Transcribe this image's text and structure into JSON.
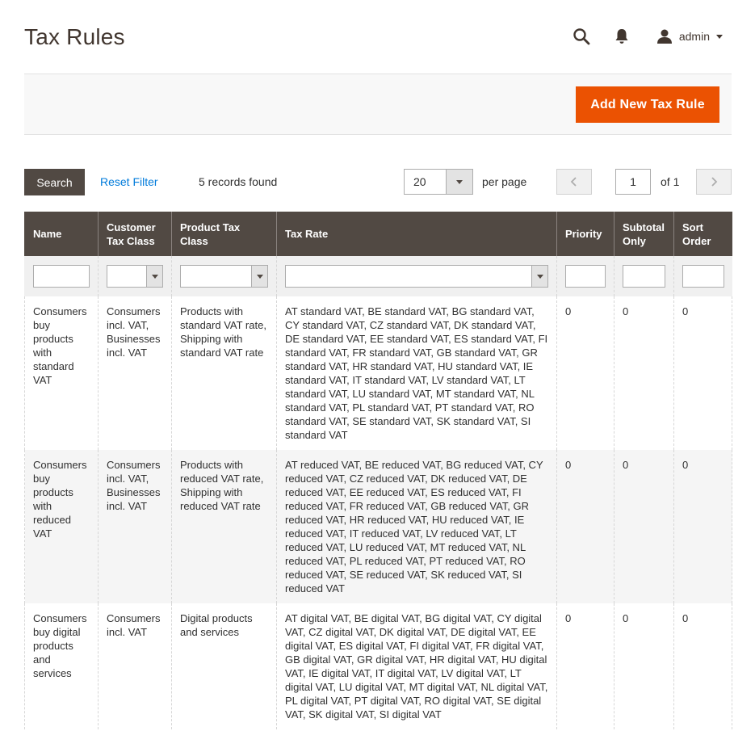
{
  "page": {
    "title": "Tax Rules"
  },
  "header": {
    "user_name": "admin"
  },
  "actions": {
    "add_button": "Add New Tax Rule"
  },
  "toolbar": {
    "search_button": "Search",
    "reset_filter": "Reset Filter",
    "records_found": "5 records found",
    "per_page_value": "20",
    "per_page_label": "per page",
    "current_page": "1",
    "of_pages": "of 1"
  },
  "grid": {
    "columns": [
      "Name",
      "Customer Tax Class",
      "Product Tax Class",
      "Tax Rate",
      "Priority",
      "Subtotal Only",
      "Sort Order"
    ],
    "rows": [
      {
        "name": "Consumers buy products with standard VAT",
        "customer_tax_class": "Consumers incl. VAT, Businesses incl. VAT",
        "product_tax_class": "Products with standard VAT rate, Shipping with standard VAT rate",
        "tax_rate": "AT standard VAT, BE standard VAT, BG standard VAT, CY standard VAT, CZ standard VAT, DK standard VAT, DE standard VAT, EE standard VAT, ES standard VAT, FI standard VAT, FR standard VAT, GB standard VAT, GR standard VAT, HR standard VAT, HU standard VAT, IE standard VAT, IT standard VAT, LV standard VAT, LT standard VAT, LU standard VAT, MT standard VAT, NL standard VAT, PL standard VAT, PT standard VAT, RO standard VAT, SE standard VAT, SK standard VAT, SI standard VAT",
        "priority": "0",
        "subtotal_only": "0",
        "sort_order": "0"
      },
      {
        "name": "Consumers buy products with reduced VAT",
        "customer_tax_class": "Consumers incl. VAT, Businesses incl. VAT",
        "product_tax_class": "Products with reduced VAT rate, Shipping with reduced VAT rate",
        "tax_rate": "AT reduced VAT, BE reduced VAT, BG reduced VAT, CY reduced VAT, CZ reduced VAT, DK reduced VAT, DE reduced VAT, EE reduced VAT, ES reduced VAT, FI reduced VAT, FR reduced VAT, GB reduced VAT, GR reduced VAT, HR reduced VAT, HU reduced VAT, IE reduced VAT, IT reduced VAT, LV reduced VAT, LT reduced VAT, LU reduced VAT, MT reduced VAT, NL reduced VAT, PL reduced VAT, PT reduced VAT, RO reduced VAT, SE reduced VAT, SK reduced VAT, SI reduced VAT",
        "priority": "0",
        "subtotal_only": "0",
        "sort_order": "0"
      },
      {
        "name": "Consumers buy digital products and services",
        "customer_tax_class": "Consumers incl. VAT",
        "product_tax_class": "Digital products and services",
        "tax_rate": "AT digital VAT, BE digital VAT, BG digital VAT, CY digital VAT, CZ digital VAT, DK digital VAT, DE digital VAT, EE digital VAT, ES digital VAT, FI digital VAT, FR digital VAT, GB digital VAT, GR digital VAT, HR digital VAT, HU digital VAT, IE digital VAT, IT digital VAT, LV digital VAT, LT digital VAT, LU digital VAT, MT digital VAT, NL digital VAT, PL digital VAT, PT digital VAT, RO digital VAT, SE digital VAT, SK digital VAT, SI digital VAT",
        "priority": "0",
        "subtotal_only": "0",
        "sort_order": "0"
      }
    ]
  }
}
